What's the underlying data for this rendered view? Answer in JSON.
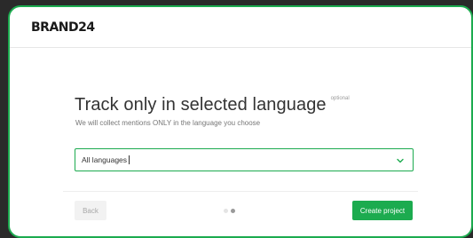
{
  "app": {
    "brand": "BRAND24",
    "accent_color": "#1cab4f"
  },
  "main": {
    "title": "Track only in selected language",
    "optional_label": "optional",
    "subtitle": "We will collect mentions ONLY in the language you choose"
  },
  "language_select": {
    "value": "All languages",
    "icon": "chevron-down-icon"
  },
  "footer": {
    "back_label": "Back",
    "create_label": "Create project",
    "steps_total": 2,
    "current_step": 2
  }
}
